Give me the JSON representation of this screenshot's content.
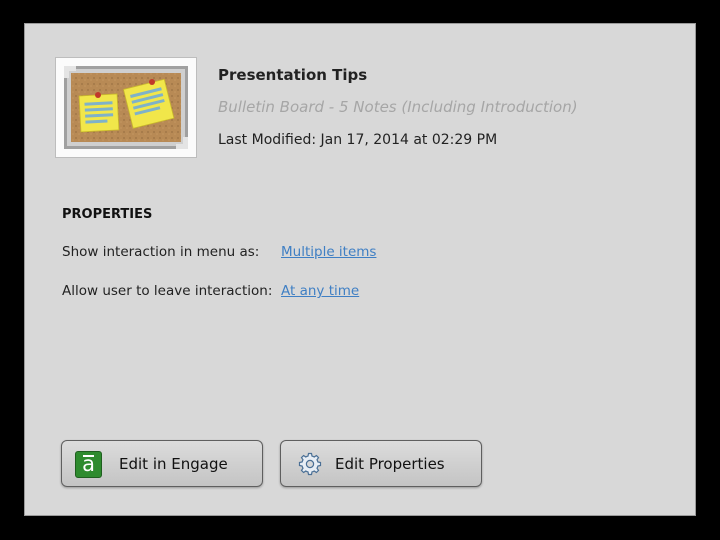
{
  "interaction": {
    "title": "Presentation Tips",
    "subtitle": "Bulletin Board - 5 Notes (Including Introduction)",
    "last_modified": "Last Modified: Jan 17, 2014 at 02:29 PM",
    "thumbnail_icon": "bulletin-board-icon"
  },
  "properties": {
    "heading": "PROPERTIES",
    "rows": [
      {
        "label": "Show interaction in menu as:",
        "value": "Multiple items"
      },
      {
        "label": "Allow user to leave interaction:",
        "value": "At any time"
      }
    ]
  },
  "buttons": {
    "edit_engage": {
      "label": "Edit in Engage",
      "icon": "engage-icon",
      "icon_glyph": "a"
    },
    "edit_properties": {
      "label": "Edit Properties",
      "icon": "gear-icon"
    }
  },
  "colors": {
    "background": "#000000",
    "panel": "#d8d8d8",
    "link": "#3f7fc4",
    "subtitle": "#a6a6a6",
    "engage_green": "#2e8b2e"
  }
}
